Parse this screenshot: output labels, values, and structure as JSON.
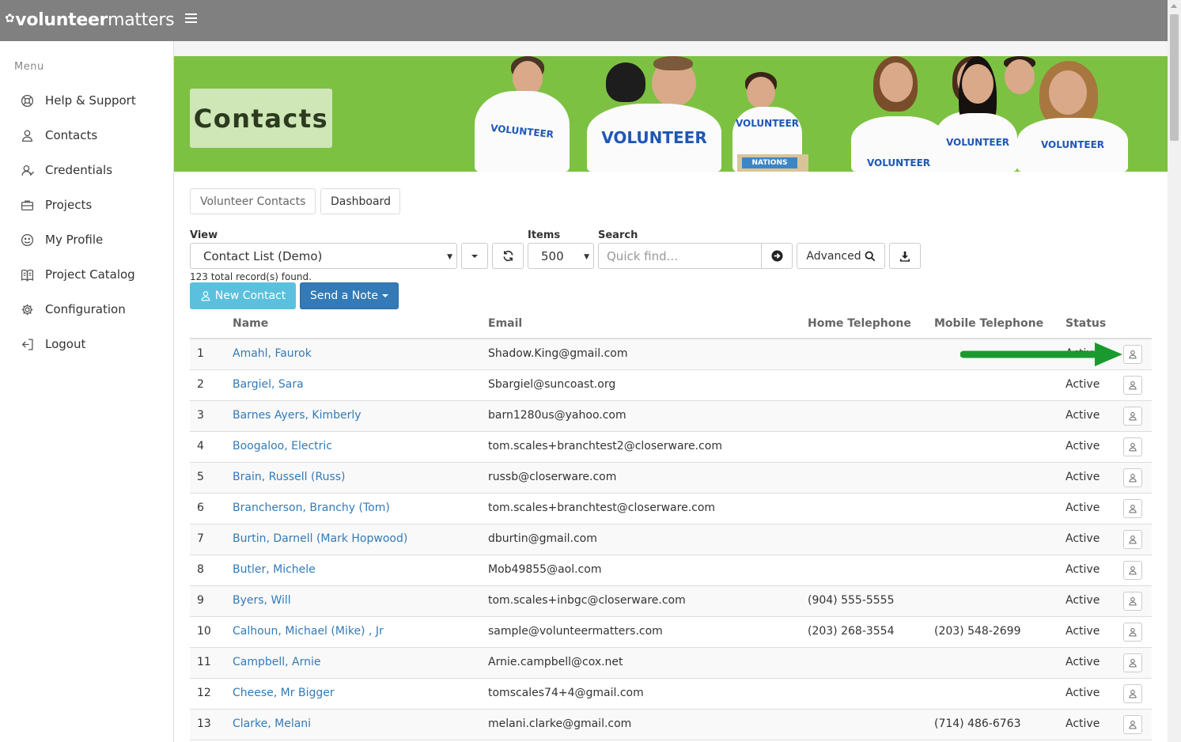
{
  "brand": {
    "logo_bold": "volunteer",
    "logo_light": "matters"
  },
  "sidebar": {
    "menu_label": "Menu",
    "items": [
      {
        "label": "Help & Support",
        "icon": "lifebuoy-icon"
      },
      {
        "label": "Contacts",
        "icon": "user-icon"
      },
      {
        "label": "Credentials",
        "icon": "credential-icon"
      },
      {
        "label": "Projects",
        "icon": "briefcase-icon"
      },
      {
        "label": "My Profile",
        "icon": "smile-icon"
      },
      {
        "label": "Project Catalog",
        "icon": "book-icon"
      },
      {
        "label": "Configuration",
        "icon": "gear-icon"
      },
      {
        "label": "Logout",
        "icon": "logout-icon"
      }
    ]
  },
  "banner": {
    "title": "Contacts",
    "shirt_text": "VOLUNTEER",
    "box_text": "NATIONS",
    "color": "#7dc142"
  },
  "tabs": {
    "volunteer_contacts": "Volunteer Contacts",
    "dashboard": "Dashboard"
  },
  "controls": {
    "view_label": "View",
    "view_value": "Contact List (Demo)",
    "items_label": "Items",
    "items_value": "500",
    "search_label": "Search",
    "search_placeholder": "Quick find...",
    "advanced_label": "Advanced"
  },
  "records_found": "123 total record(s) found.",
  "actions": {
    "new_contact": "New Contact",
    "send_note": "Send a Note"
  },
  "table": {
    "headers": {
      "name": "Name",
      "email": "Email",
      "home": "Home Telephone",
      "mobile": "Mobile Telephone",
      "status": "Status"
    },
    "rows": [
      {
        "num": "1",
        "name": "Amahl, Faurok",
        "email": "Shadow.King@gmail.com",
        "home": "",
        "mobile": "",
        "status": "Active"
      },
      {
        "num": "2",
        "name": "Bargiel, Sara",
        "email": "Sbargiel@suncoast.org",
        "home": "",
        "mobile": "",
        "status": "Active"
      },
      {
        "num": "3",
        "name": "Barnes Ayers, Kimberly",
        "email": "barn1280us@yahoo.com",
        "home": "",
        "mobile": "",
        "status": "Active"
      },
      {
        "num": "4",
        "name": "Boogaloo, Electric",
        "email": "tom.scales+branchtest2@closerware.com",
        "home": "",
        "mobile": "",
        "status": "Active"
      },
      {
        "num": "5",
        "name": "Brain, Russell (Russ)",
        "email": "russb@closerware.com",
        "home": "",
        "mobile": "",
        "status": "Active"
      },
      {
        "num": "6",
        "name": "Brancherson, Branchy (Tom)",
        "email": "tom.scales+branchtest@closerware.com",
        "home": "",
        "mobile": "",
        "status": "Active"
      },
      {
        "num": "7",
        "name": "Burtin, Darnell (Mark Hopwood)",
        "email": "dburtin@gmail.com",
        "home": "",
        "mobile": "",
        "status": "Active"
      },
      {
        "num": "8",
        "name": "Butler, Michele",
        "email": "Mob49855@aol.com",
        "home": "",
        "mobile": "",
        "status": "Active"
      },
      {
        "num": "9",
        "name": "Byers, Will",
        "email": "tom.scales+inbgc@closerware.com",
        "home": "(904) 555-5555",
        "mobile": "",
        "status": "Active"
      },
      {
        "num": "10",
        "name": "Calhoun, Michael (Mike) , Jr",
        "email": "sample@volunteermatters.com",
        "home": "(203) 268-3554",
        "mobile": "(203) 548-2699",
        "status": "Active"
      },
      {
        "num": "11",
        "name": "Campbell, Arnie",
        "email": "Arnie.campbell@cox.net",
        "home": "",
        "mobile": "",
        "status": "Active"
      },
      {
        "num": "12",
        "name": "Cheese, Mr Bigger",
        "email": "tomscales74+4@gmail.com",
        "home": "",
        "mobile": "",
        "status": "Active"
      },
      {
        "num": "13",
        "name": "Clarke, Melani",
        "email": "melani.clarke@gmail.com",
        "home": "",
        "mobile": "(714) 486-6763",
        "status": "Active"
      }
    ]
  },
  "annotation": {
    "arrow_color": "#1a9a2e"
  },
  "colors": {
    "topbar": "#808080",
    "link": "#337ab7",
    "primary": "#337ab7",
    "info": "#5bc0de"
  }
}
